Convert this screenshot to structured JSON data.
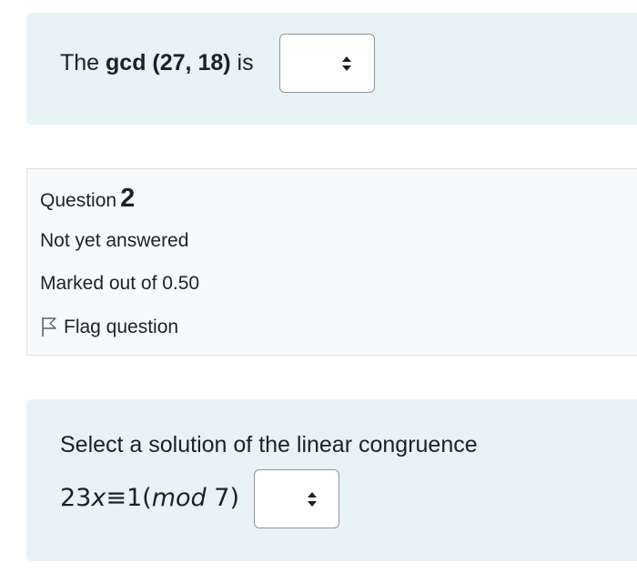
{
  "question1": {
    "text_before": "The ",
    "text_bold": "gcd (27, 18)",
    "text_after": " is",
    "dropdown": {
      "selected": ""
    }
  },
  "question2_info": {
    "label": "Question",
    "number": "2",
    "state": "Not yet answered",
    "grade": "Marked out of 0.50",
    "flag_label": "Flag question",
    "flag_icon": "flag-outline-icon"
  },
  "question2": {
    "prompt": "Select a solution of the linear congruence",
    "formula": {
      "coef": "23",
      "var": "x",
      "equiv": "≡",
      "rhs": "1",
      "open_paren": "(",
      "mod": "mod",
      "modulus": "7",
      "close_paren": ")"
    },
    "dropdown": {
      "selected": ""
    }
  },
  "colors": {
    "panel_background": "#e7f3f5",
    "info_background": "#f8f9fa",
    "text": "#1d2125",
    "border": "#8f959e"
  }
}
